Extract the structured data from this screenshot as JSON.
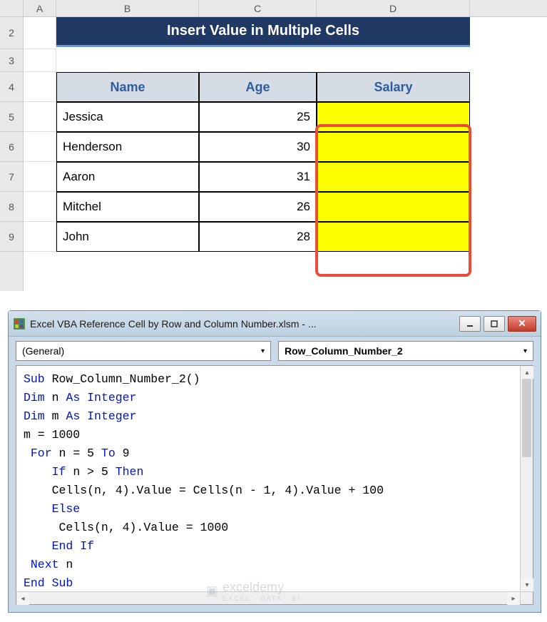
{
  "columns": {
    "a": "A",
    "b": "B",
    "c": "C",
    "d": "D"
  },
  "rows": {
    "r2": "2",
    "r3": "3",
    "r4": "4",
    "r5": "5",
    "r6": "6",
    "r7": "7",
    "r8": "8",
    "r9": "9"
  },
  "title": "Insert Value in Multiple Cells",
  "headers": {
    "name": "Name",
    "age": "Age",
    "salary": "Salary"
  },
  "data": [
    {
      "name": "Jessica",
      "age": "25",
      "salary": ""
    },
    {
      "name": "Henderson",
      "age": "30",
      "salary": ""
    },
    {
      "name": "Aaron",
      "age": "31",
      "salary": ""
    },
    {
      "name": "Mitchel",
      "age": "26",
      "salary": ""
    },
    {
      "name": "John",
      "age": "28",
      "salary": ""
    }
  ],
  "vba": {
    "window_title": "Excel VBA Reference Cell by Row and Column Number.xlsm - ...",
    "dropdown_left": "(General)",
    "dropdown_right": "Row_Column_Number_2",
    "code": {
      "l1a": "Sub",
      "l1b": " Row_Column_Number_2()",
      "l2a": "Dim",
      "l2b": " n ",
      "l2c": "As Integer",
      "l3a": "Dim",
      "l3b": " m ",
      "l3c": "As Integer",
      "l4": "m = 1000",
      "l5a": " For",
      "l5b": " n = 5 ",
      "l5c": "To",
      "l5d": " 9",
      "l6a": "    If",
      "l6b": " n > 5 ",
      "l6c": "Then",
      "l7": "    Cells(n, 4).Value = Cells(n - 1, 4).Value + 100",
      "l8": "    Else",
      "l9": "     Cells(n, 4).Value = 1000",
      "l10": "    End If",
      "l11a": " Next",
      "l11b": " n",
      "l12": "End Sub"
    }
  },
  "watermark": {
    "main": "exceldemy",
    "sub": "EXCEL · DATA · BI"
  }
}
